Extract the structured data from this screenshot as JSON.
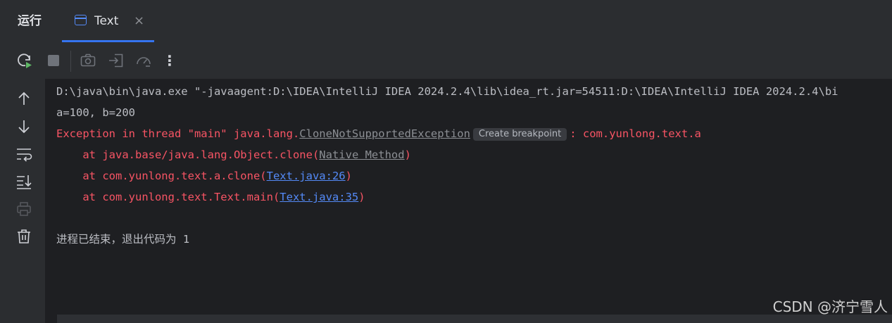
{
  "header": {
    "run_title": "运行",
    "tab_label": "Text",
    "tab_close": "×"
  },
  "toolbar": {
    "icons": [
      "rerun-icon",
      "stop-icon",
      "screenshot-icon",
      "restore-layout-icon",
      "profiler-icon",
      "more-options-icon"
    ],
    "more_glyph": "⋮"
  },
  "sidebar": {
    "icons": [
      "up-arrow-icon",
      "down-arrow-icon",
      "soft-wrap-icon",
      "scroll-to-end-icon",
      "print-icon",
      "trash-icon"
    ]
  },
  "console": {
    "line1": "D:\\java\\bin\\java.exe \"-javaagent:D:\\IDEA\\IntelliJ IDEA 2024.2.4\\lib\\idea_rt.jar=54511:D:\\IDEA\\IntelliJ IDEA 2024.2.4\\bi",
    "line2": "a=100, b=200",
    "line3_prefix": "Exception in thread \"main\" java.lang.",
    "line3_exception": "CloneNotSupportedException",
    "line3_hint": "Create breakpoint",
    "line3_suffix": ": com.yunlong.text.a",
    "line4_prefix": "    at java.base/java.lang.Object.clone(",
    "line4_link": "Native Method",
    "line4_suffix": ")",
    "line5_prefix": "    at com.yunlong.text.a.clone(",
    "line5_link": "Text.java:26",
    "line5_suffix": ")",
    "line6_prefix": "    at com.yunlong.text.Text.main(",
    "line6_link": "Text.java:35",
    "line6_suffix": ")",
    "line8": "进程已结束，退出代码为 1"
  },
  "watermark": "CSDN @济宁雪人",
  "colors": {
    "error": "#f75464",
    "link": "#548af7",
    "text": "#bcbec4",
    "accent": "#3574f0",
    "run_green": "#5fb865"
  }
}
